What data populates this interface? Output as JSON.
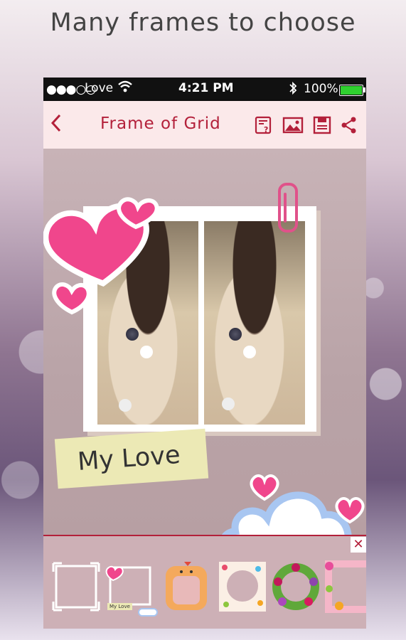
{
  "headline": "Many frames to choose",
  "status_bar": {
    "signal": "●●●○○",
    "carrier": "Love",
    "time": "4:21 PM",
    "battery": "100%"
  },
  "toolbar": {
    "title": "Frame of Grid",
    "icons": [
      "back-icon",
      "help-document-icon",
      "image-icon",
      "save-icon",
      "share-icon"
    ]
  },
  "canvas": {
    "sticker_text": "My Love"
  },
  "frame_picker": {
    "close_label": "✕",
    "thumbnails": [
      "simple-frame",
      "my-love-frame",
      "chick-frame",
      "pattern-circle-frame",
      "flower-wreath-frame",
      "floral-frame"
    ],
    "thumb_caption": "My Love"
  },
  "colors": {
    "accent": "#b3203a",
    "toolbar_bg": "#fbe9ea",
    "heart": "#f0468c",
    "cloud_outline": "#a8c6f1"
  }
}
